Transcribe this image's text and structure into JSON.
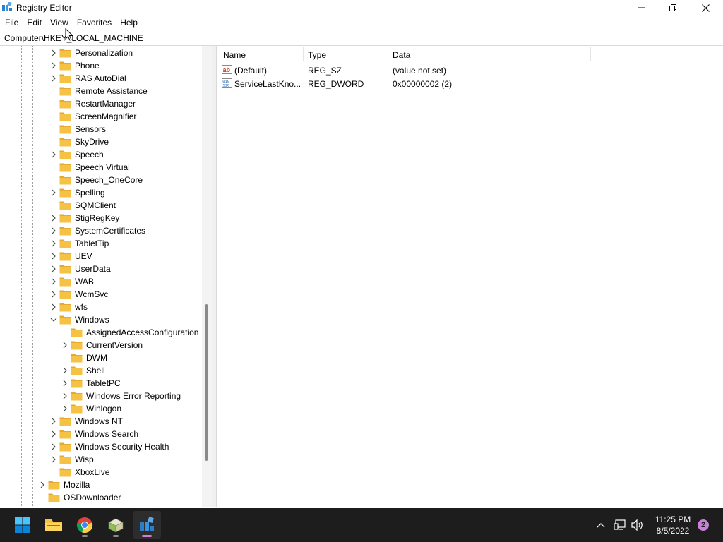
{
  "window": {
    "title": "Registry Editor",
    "icon": "regedit-icon"
  },
  "menu": [
    "File",
    "Edit",
    "View",
    "Favorites",
    "Help"
  ],
  "address": "Computer\\HKEY_LOCAL_MACHINE",
  "tree": {
    "items": [
      {
        "label": "Personalization",
        "expandable": true
      },
      {
        "label": "Phone",
        "expandable": true
      },
      {
        "label": "RAS AutoDial",
        "expandable": true
      },
      {
        "label": "Remote Assistance",
        "expandable": false
      },
      {
        "label": "RestartManager",
        "expandable": false
      },
      {
        "label": "ScreenMagnifier",
        "expandable": false
      },
      {
        "label": "Sensors",
        "expandable": false
      },
      {
        "label": "SkyDrive",
        "expandable": false
      },
      {
        "label": "Speech",
        "expandable": true
      },
      {
        "label": "Speech Virtual",
        "expandable": false
      },
      {
        "label": "Speech_OneCore",
        "expandable": false
      },
      {
        "label": "Spelling",
        "expandable": true
      },
      {
        "label": "SQMClient",
        "expandable": false
      },
      {
        "label": "StigRegKey",
        "expandable": true
      },
      {
        "label": "SystemCertificates",
        "expandable": true
      },
      {
        "label": "TabletTip",
        "expandable": true
      },
      {
        "label": "UEV",
        "expandable": true
      },
      {
        "label": "UserData",
        "expandable": true
      },
      {
        "label": "WAB",
        "expandable": true
      },
      {
        "label": "WcmSvc",
        "expandable": true
      },
      {
        "label": "wfs",
        "expandable": true
      },
      {
        "label": "Windows",
        "expandable": true,
        "expanded": true
      },
      {
        "label": "AssignedAccessConfiguration",
        "expandable": false,
        "child": true
      },
      {
        "label": "CurrentVersion",
        "expandable": true,
        "child": true
      },
      {
        "label": "DWM",
        "expandable": false,
        "child": true
      },
      {
        "label": "Shell",
        "expandable": true,
        "child": true
      },
      {
        "label": "TabletPC",
        "expandable": true,
        "child": true
      },
      {
        "label": "Windows Error Reporting",
        "expandable": true,
        "child": true
      },
      {
        "label": "Winlogon",
        "expandable": true,
        "child": true
      },
      {
        "label": "Windows NT",
        "expandable": true
      },
      {
        "label": "Windows Search",
        "expandable": true
      },
      {
        "label": "Windows Security Health",
        "expandable": true
      },
      {
        "label": "Wisp",
        "expandable": true
      },
      {
        "label": "XboxLive",
        "expandable": false
      },
      {
        "label": "Mozilla",
        "expandable": true,
        "parent": true
      },
      {
        "label": "OSDownloader",
        "expandable": false,
        "parent": true
      }
    ]
  },
  "list": {
    "columns": [
      "Name",
      "Type",
      "Data"
    ],
    "rows": [
      {
        "name": "(Default)",
        "type": "REG_SZ",
        "data": "(value not set)",
        "icon": "string-value-icon"
      },
      {
        "name": "ServiceLastKno...",
        "type": "REG_DWORD",
        "data": "0x00000002 (2)",
        "icon": "binary-value-icon"
      }
    ]
  },
  "taskbar": {
    "apps": [
      "start-button",
      "file-explorer",
      "chrome",
      "app-installer",
      "registry-editor"
    ],
    "time": "11:25 PM",
    "date": "8/5/2022",
    "notifications": "2"
  },
  "colors": {
    "folder": "#f5c243",
    "taskbar": "#1d1d1d",
    "accent": "#0078d4"
  }
}
